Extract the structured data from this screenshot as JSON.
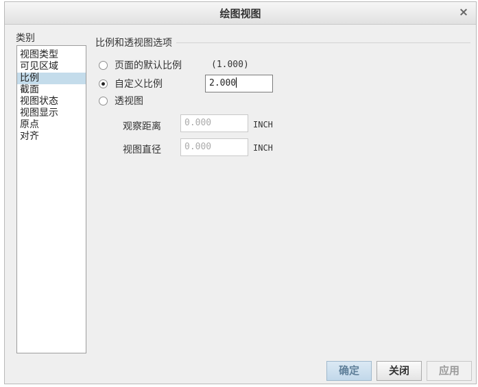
{
  "dialog": {
    "title": "绘图视图",
    "close_glyph": "×"
  },
  "categories": {
    "label": "类别",
    "items": [
      "视图类型",
      "可见区域",
      "比例",
      "截面",
      "视图状态",
      "视图显示",
      "原点",
      "对齐"
    ],
    "selected": "比例"
  },
  "group": {
    "title": "比例和透视图选项"
  },
  "options": {
    "default_scale": {
      "label": "页面的默认比例",
      "hint": "(1.000)",
      "checked": false
    },
    "custom_scale": {
      "label": "自定义比例",
      "value": "2.000",
      "checked": true
    },
    "perspective": {
      "label": "透视图",
      "checked": false
    }
  },
  "perspective_fields": {
    "distance": {
      "label": "观察距离",
      "value": "0.000",
      "unit": "INCH"
    },
    "diameter": {
      "label": "视图直径",
      "value": "0.000",
      "unit": "INCH"
    }
  },
  "buttons": {
    "ok": "确定",
    "close": "关闭",
    "apply": "应用"
  }
}
